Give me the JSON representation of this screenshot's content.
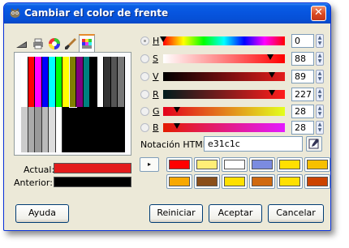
{
  "window": {
    "title": "Cambiar el color de frente",
    "close_label": "✕"
  },
  "palette": {
    "columns_top": [
      "#ffffff",
      "#ff0000",
      "#ff00ff",
      "#0000ff",
      "#00ffff",
      "#00ff00",
      "#ffff00",
      "#808000",
      "#800080",
      "#008080",
      "#000000",
      "#ffffff",
      "#333333",
      "#555555",
      "#777777"
    ],
    "grays_bottom": [
      "#cccccc",
      "#aaaaaa",
      "#999999",
      "#bbbbbb",
      "#dddddd",
      "#ffffff"
    ]
  },
  "current": {
    "actual_label": "Actual:",
    "anterior_label": "Anterior:",
    "actual_color": "#e31c1c",
    "anterior_color": "#000000"
  },
  "sliders": [
    {
      "key": "H",
      "value": "0",
      "fraction": 0.0,
      "gradient": "linear-gradient(to right,#ff0000,#ffff00,#00ff00,#00ffff,#0000ff,#ff00ff,#ff0000)"
    },
    {
      "key": "S",
      "value": "88",
      "fraction": 0.88,
      "gradient": "linear-gradient(to right,#ffffff,#ff0000)"
    },
    {
      "key": "V",
      "value": "89",
      "fraction": 0.89,
      "gradient": "linear-gradient(to right,#000000,#e31c1c)"
    },
    {
      "key": "R",
      "value": "227",
      "fraction": 0.89,
      "gradient": "linear-gradient(to right,#001c1c,#ff1c1c)"
    },
    {
      "key": "G",
      "value": "28",
      "fraction": 0.11,
      "gradient": "linear-gradient(to right,#e3001c,#e3ff1c)"
    },
    {
      "key": "B",
      "value": "28",
      "fraction": 0.11,
      "gradient": "linear-gradient(to right,#e31c00,#e31cff)"
    }
  ],
  "html": {
    "label": "Notación HTML:",
    "value": "e31c1c"
  },
  "history": {
    "arrow": "▸",
    "colors": [
      "#ff0000",
      "#ffee77",
      "#ffffff",
      "#7b8be0",
      "#ffe000",
      "#f7c000",
      "#f8a800",
      "#8a4f1a",
      "#ffe000",
      "#d06a10",
      "#ffe000",
      "#cc4400"
    ]
  },
  "buttons": {
    "help": "Ayuda",
    "reset": "Reiniciar",
    "accept": "Aceptar",
    "cancel": "Cancelar"
  }
}
